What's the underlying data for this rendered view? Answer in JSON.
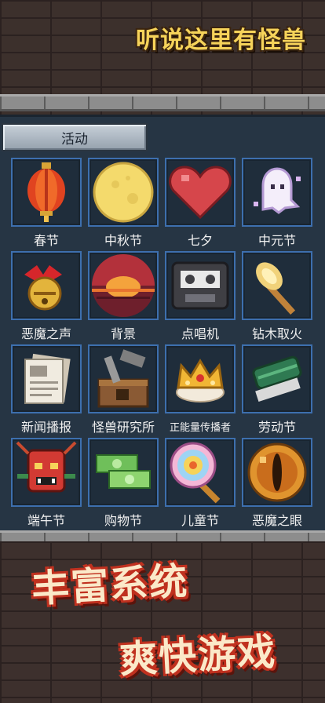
{
  "header": {
    "game_title": "听说这里有怪兽"
  },
  "panel": {
    "tab_label": "活动",
    "items": [
      {
        "label": "春节",
        "icon": "lantern-icon"
      },
      {
        "label": "中秋节",
        "icon": "moon-icon"
      },
      {
        "label": "七夕",
        "icon": "heart-icon"
      },
      {
        "label": "中元节",
        "icon": "ghost-icon"
      },
      {
        "label": "恶魔之声",
        "icon": "bell-icon"
      },
      {
        "label": "背景",
        "icon": "sunset-icon"
      },
      {
        "label": "点唱机",
        "icon": "cassette-icon"
      },
      {
        "label": "钻木取火",
        "icon": "fire-stick-icon"
      },
      {
        "label": "新闻播报",
        "icon": "newspaper-icon"
      },
      {
        "label": "怪兽研究所",
        "icon": "workshop-icon"
      },
      {
        "label": "正能量传播者",
        "icon": "crown-icon"
      },
      {
        "label": "劳动节",
        "icon": "brush-icon"
      },
      {
        "label": "端午节",
        "icon": "dragon-mask-icon"
      },
      {
        "label": "购物节",
        "icon": "cash-icon"
      },
      {
        "label": "儿童节",
        "icon": "lollipop-icon"
      },
      {
        "label": "恶魔之眼",
        "icon": "demon-eye-icon"
      }
    ]
  },
  "slogan": {
    "line1": "丰富系统",
    "line2": "爽快游戏"
  }
}
